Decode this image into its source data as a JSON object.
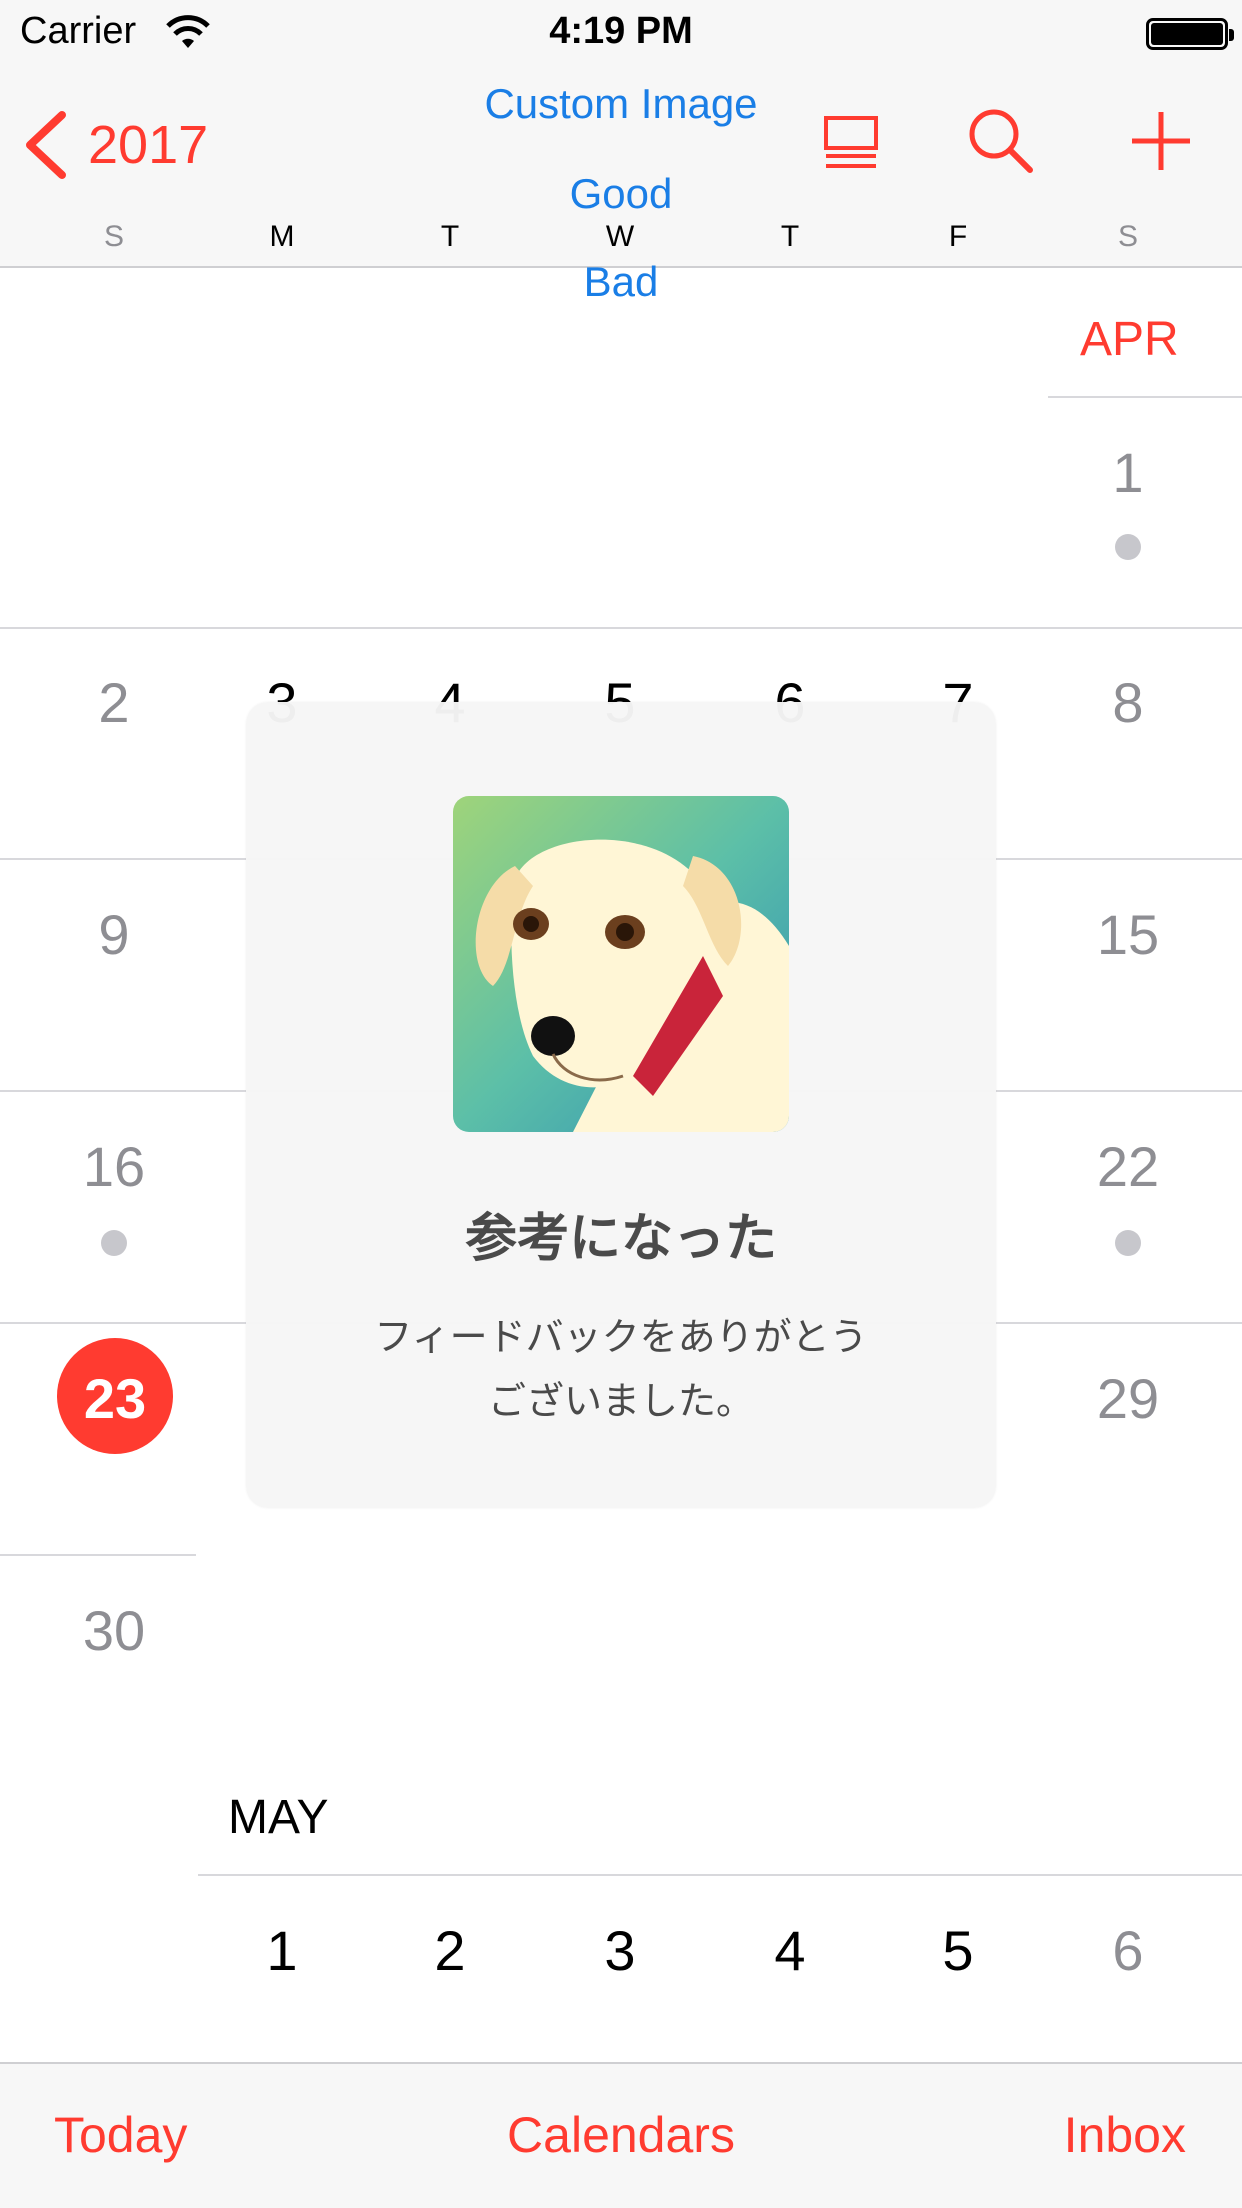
{
  "status": {
    "carrier": "Carrier",
    "time": "4:19 PM"
  },
  "nav": {
    "back_label": "2017",
    "title": "Custom Image",
    "good_label": "Good",
    "bad_label": "Bad"
  },
  "weekdays": [
    "S",
    "M",
    "T",
    "W",
    "T",
    "F",
    "S"
  ],
  "april": {
    "label": "APR",
    "days": [
      "1",
      "2",
      "3",
      "4",
      "5",
      "6",
      "7",
      "8",
      "9",
      "15",
      "16",
      "22",
      "23",
      "29",
      "30"
    ]
  },
  "may": {
    "label": "MAY",
    "days": [
      "1",
      "2",
      "3",
      "4",
      "5",
      "6"
    ]
  },
  "overlay": {
    "title": "参考になった",
    "message_line1": "フィードバックをありがとう",
    "message_line2": "ございました。"
  },
  "tabs": {
    "today": "Today",
    "calendars": "Calendars",
    "inbox": "Inbox"
  },
  "colors": {
    "accent": "#ff3b30",
    "link": "#1a7ee6",
    "muted": "#8e8e93"
  }
}
